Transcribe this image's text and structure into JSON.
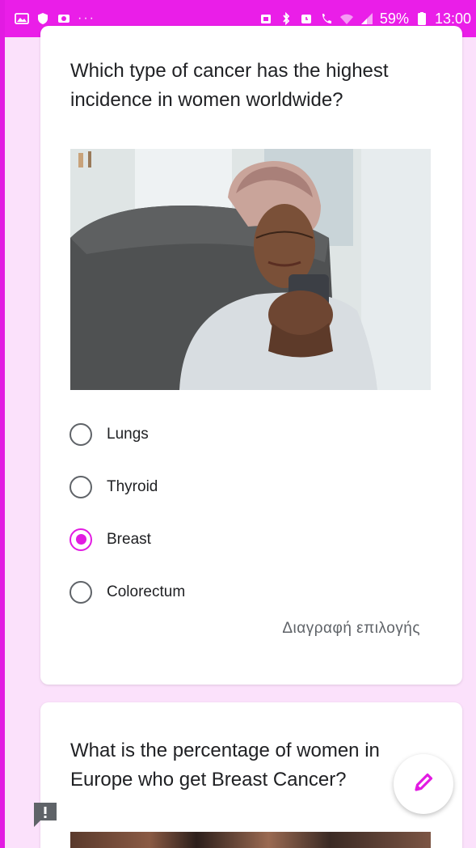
{
  "status_bar": {
    "dots": "···",
    "battery_percent": "59%",
    "time": "13:00",
    "left_icons": [
      "image-icon",
      "shield-icon",
      "sync-icon"
    ],
    "right_icons": [
      "alarm-icon",
      "bluetooth-icon",
      "alarm-clock-icon",
      "phone-call-icon",
      "wifi-icon",
      "signal-icon",
      "battery-icon"
    ]
  },
  "question1": {
    "text": "Which type of cancer has the highest incidence in women worldwide?",
    "options": [
      {
        "label": "Lungs",
        "selected": false
      },
      {
        "label": "Thyroid",
        "selected": false
      },
      {
        "label": "Breast",
        "selected": true
      },
      {
        "label": "Colorectum",
        "selected": false
      }
    ],
    "clear_selection": "Διαγραφή επιλογής"
  },
  "question2": {
    "text": "What is the percentage of women in Europe who get Breast Cancer?"
  },
  "fab": {
    "icon": "pencil-icon"
  },
  "report": {
    "icon": "report-icon"
  },
  "colors": {
    "accent": "#e21be2",
    "status_bar": "#ea1ee8",
    "page_background": "#fbe1fb",
    "card": "#ffffff"
  }
}
